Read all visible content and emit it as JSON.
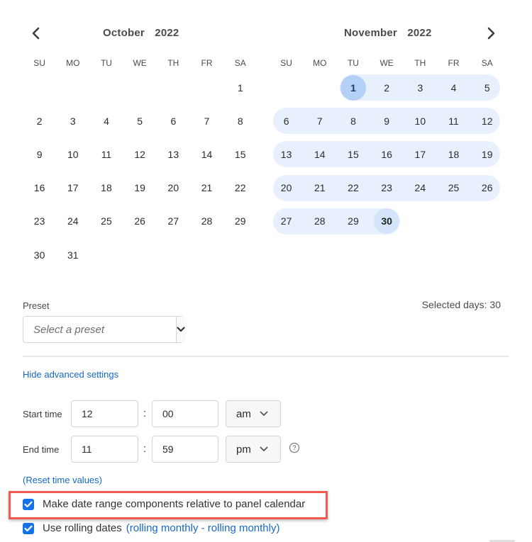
{
  "calendar": {
    "prev_icon": "chevron-left-icon",
    "next_icon": "chevron-right-icon",
    "weekdays": [
      "SU",
      "MO",
      "TU",
      "WE",
      "TH",
      "FR",
      "SA"
    ],
    "months": [
      {
        "name": "October",
        "year": "2022",
        "weeks": [
          [
            "",
            "",
            "",
            "",
            "",
            "",
            "1"
          ],
          [
            "2",
            "3",
            "4",
            "5",
            "6",
            "7",
            "8"
          ],
          [
            "9",
            "10",
            "11",
            "12",
            "13",
            "14",
            "15"
          ],
          [
            "16",
            "17",
            "18",
            "19",
            "20",
            "21",
            "22"
          ],
          [
            "23",
            "24",
            "25",
            "26",
            "27",
            "28",
            "29"
          ],
          [
            "30",
            "31",
            "",
            "",
            "",
            "",
            ""
          ]
        ]
      },
      {
        "name": "November",
        "year": "2022",
        "weeks": [
          [
            "",
            "",
            "1",
            "2",
            "3",
            "4",
            "5"
          ],
          [
            "6",
            "7",
            "8",
            "9",
            "10",
            "11",
            "12"
          ],
          [
            "13",
            "14",
            "15",
            "16",
            "17",
            "18",
            "19"
          ],
          [
            "20",
            "21",
            "22",
            "23",
            "24",
            "25",
            "26"
          ],
          [
            "27",
            "28",
            "29",
            "30",
            "",
            "",
            ""
          ]
        ]
      }
    ],
    "selection": {
      "month": "November",
      "start": "1",
      "end": "30"
    }
  },
  "preset": {
    "label": "Preset",
    "placeholder": "Select a preset",
    "dropdown_icon": "chevron-down-icon"
  },
  "selected_days_text": "Selected days: 30",
  "advanced": {
    "toggle_link": "Hide advanced settings",
    "start_time": {
      "label": "Start time",
      "hour": "12",
      "minute": "00",
      "period": "am"
    },
    "end_time": {
      "label": "End time",
      "hour": "11",
      "minute": "59",
      "period": "pm"
    },
    "separator": ":",
    "help_icon": "question-circle-icon",
    "help_glyph": "?",
    "reset_link": "(Reset time values)"
  },
  "options": {
    "relative_to_panel": {
      "label": "Make date range components relative to panel calendar",
      "checked": true
    },
    "rolling_dates": {
      "label": "Use rolling dates",
      "checked": true,
      "detail_link": "(rolling monthly - rolling monthly)"
    }
  },
  "colors": {
    "accent": "#1473e6",
    "link": "#1468c8",
    "range_band": "#e8f0fd",
    "range_start": "#b5d0f7",
    "range_end": "#d3e4fb",
    "highlight_border": "#f25a50"
  }
}
